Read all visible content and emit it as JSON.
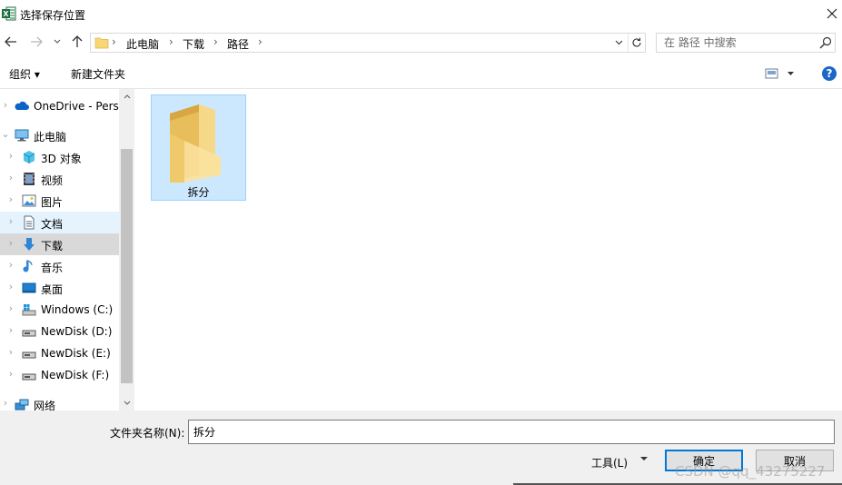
{
  "window": {
    "title": "选择保存位置",
    "app_icon_letter": "X"
  },
  "address": {
    "crumbs": [
      "此电脑",
      "下载",
      "路径"
    ],
    "search_placeholder": "在 路径 中搜索"
  },
  "toolbar": {
    "organize": "组织 ▾",
    "new_folder": "新建文件夹",
    "help": "?"
  },
  "nav_tree": [
    {
      "label": "OneDrive - Perso",
      "icon": "onedrive-icon",
      "level": 0
    },
    {
      "label": "此电脑",
      "icon": "computer-icon",
      "level": 0,
      "expanded": true
    },
    {
      "label": "3D 对象",
      "icon": "3d-objects-icon",
      "level": 1
    },
    {
      "label": "视频",
      "icon": "video-icon",
      "level": 1
    },
    {
      "label": "图片",
      "icon": "pictures-icon",
      "level": 1
    },
    {
      "label": "文档",
      "icon": "documents-icon",
      "level": 1,
      "state": "hover"
    },
    {
      "label": "下载",
      "icon": "downloads-icon",
      "level": 1,
      "state": "selected"
    },
    {
      "label": "音乐",
      "icon": "music-icon",
      "level": 1
    },
    {
      "label": "桌面",
      "icon": "desktop-icon",
      "level": 1
    },
    {
      "label": "Windows (C:)",
      "icon": "windows-drive-icon",
      "level": 1
    },
    {
      "label": "NewDisk (D:)",
      "icon": "drive-icon",
      "level": 1
    },
    {
      "label": "NewDisk (E:)",
      "icon": "drive-icon",
      "level": 1
    },
    {
      "label": "NewDisk (F:)",
      "icon": "drive-icon",
      "level": 1
    },
    {
      "label": "网络",
      "icon": "network-icon",
      "level": 0
    }
  ],
  "content": {
    "items": [
      {
        "name": "拆分",
        "type": "folder",
        "selected": true
      }
    ]
  },
  "footer": {
    "filename_label": "文件夹名称(N):",
    "filename_value": "拆分",
    "tools_label": "工具(L)",
    "ok_label": "确定",
    "cancel_label": "取消",
    "watermark": "CSDN @qq_43275227"
  },
  "colors": {
    "accent": "#0078d7",
    "selection": "#cce8ff",
    "folder": "#f8d775"
  }
}
